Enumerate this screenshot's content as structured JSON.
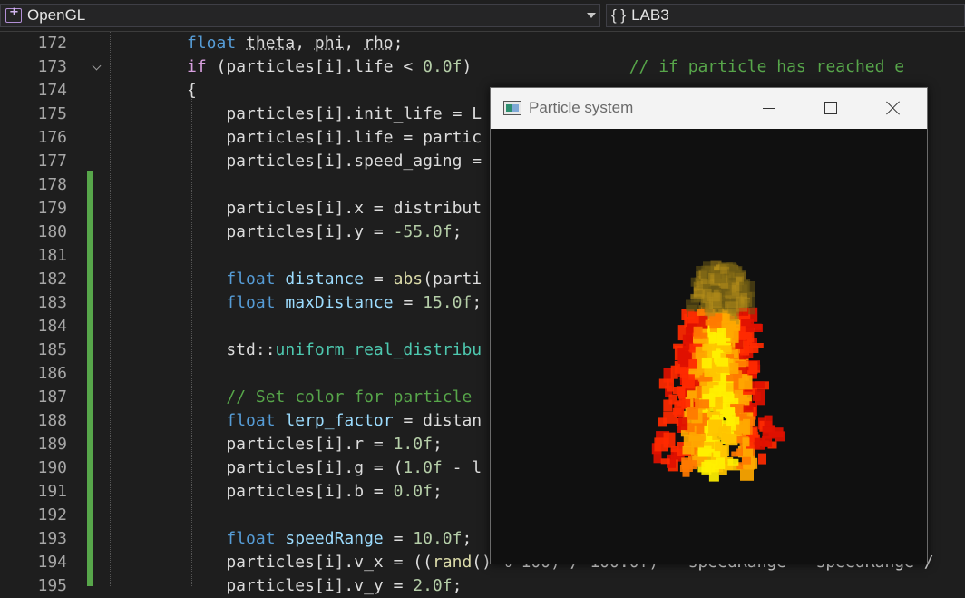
{
  "navbar": {
    "project": "OpenGL",
    "scope_icon": "{ }",
    "scope": "LAB3"
  },
  "colors": {
    "editor_bg": "#1e1e1e",
    "keyword": "#569cd6",
    "control_keyword": "#d8a0df",
    "comment": "#57a64a",
    "number": "#b5cea8",
    "type": "#4ec9b0",
    "change_bar": "#57a64a"
  },
  "editor": {
    "lines": [
      {
        "n": "172",
        "code": [
          [
            "kw",
            "float"
          ],
          [
            "t",
            " "
          ],
          [
            "lv",
            "theta"
          ],
          [
            "t",
            ", "
          ],
          [
            "lv",
            "phi"
          ],
          [
            "t",
            ", "
          ],
          [
            "lv",
            "rho"
          ],
          [
            "t",
            ";"
          ]
        ]
      },
      {
        "n": "173",
        "code": [
          [
            "kw2",
            "if"
          ],
          [
            "t",
            " (particles[i].life < "
          ],
          [
            "num",
            "0.0f"
          ],
          [
            "t",
            ")                "
          ],
          [
            "cm",
            "// if particle has reached e"
          ]
        ]
      },
      {
        "n": "174",
        "code": [
          [
            "t",
            "{"
          ]
        ]
      },
      {
        "n": "175",
        "code": [
          [
            "t",
            "    particles[i].init_life = L                                    All"
          ]
        ]
      },
      {
        "n": "176",
        "code": [
          [
            "t",
            "    particles[i].life = partic"
          ]
        ]
      },
      {
        "n": "177",
        "code": [
          [
            "t",
            "    particles[i].speed_aging ="
          ]
        ]
      },
      {
        "n": "178",
        "code": []
      },
      {
        "n": "179",
        "code": [
          [
            "t",
            "    particles[i].x = distribut"
          ]
        ]
      },
      {
        "n": "180",
        "code": [
          [
            "t",
            "    particles[i].y = "
          ],
          [
            "num",
            "-55.0f"
          ],
          [
            "t",
            ";"
          ]
        ]
      },
      {
        "n": "181",
        "code": []
      },
      {
        "n": "182",
        "code": [
          [
            "t",
            "    "
          ],
          [
            "kw",
            "float"
          ],
          [
            "t",
            " "
          ],
          [
            "var",
            "distance"
          ],
          [
            "t",
            " = "
          ],
          [
            "fn",
            "abs"
          ],
          [
            "t",
            "(parti"
          ]
        ]
      },
      {
        "n": "183",
        "code": [
          [
            "t",
            "    "
          ],
          [
            "kw",
            "float"
          ],
          [
            "t",
            " "
          ],
          [
            "var",
            "maxDistance"
          ],
          [
            "t",
            " = "
          ],
          [
            "num",
            "15.0f"
          ],
          [
            "t",
            ";"
          ]
        ]
      },
      {
        "n": "184",
        "code": []
      },
      {
        "n": "185",
        "code": [
          [
            "t",
            "    std::"
          ],
          [
            "ty",
            "uniform_real_distribu"
          ]
        ]
      },
      {
        "n": "186",
        "code": []
      },
      {
        "n": "187",
        "code": [
          [
            "t",
            "    "
          ],
          [
            "cm",
            "// Set color for particle"
          ]
        ]
      },
      {
        "n": "188",
        "code": [
          [
            "t",
            "    "
          ],
          [
            "kw",
            "float"
          ],
          [
            "t",
            " "
          ],
          [
            "var",
            "lerp_factor"
          ],
          [
            "t",
            " = distan"
          ]
        ]
      },
      {
        "n": "189",
        "code": [
          [
            "t",
            "    particles[i].r = "
          ],
          [
            "num",
            "1.0f"
          ],
          [
            "t",
            ";"
          ]
        ]
      },
      {
        "n": "190",
        "code": [
          [
            "t",
            "    particles[i].g = ("
          ],
          [
            "num",
            "1.0f"
          ],
          [
            "t",
            " - l"
          ]
        ]
      },
      {
        "n": "191",
        "code": [
          [
            "t",
            "    particles[i].b = "
          ],
          [
            "num",
            "0.0f"
          ],
          [
            "t",
            ";"
          ]
        ]
      },
      {
        "n": "192",
        "code": []
      },
      {
        "n": "193",
        "code": [
          [
            "t",
            "    "
          ],
          [
            "kw",
            "float"
          ],
          [
            "t",
            " "
          ],
          [
            "var",
            "speedRange"
          ],
          [
            "t",
            " = "
          ],
          [
            "num",
            "10.0f"
          ],
          [
            "t",
            ";"
          ]
        ]
      },
      {
        "n": "194",
        "code": [
          [
            "t",
            "    particles[i].v_x = (("
          ],
          [
            "fn",
            "rand"
          ],
          [
            "t",
            "() % 100) / 100.0f) * speedRange - speedRange /"
          ]
        ]
      },
      {
        "n": "195",
        "code": [
          [
            "t",
            "    particles[i].v_y = "
          ],
          [
            "num",
            "2.0f"
          ],
          [
            "t",
            ";"
          ]
        ]
      }
    ]
  },
  "particle_window": {
    "title": "Particle system",
    "title_icon": "app-window-icon",
    "buttons": {
      "minimize": "minimize-icon",
      "maximize": "maximize-icon",
      "close": "close-icon"
    },
    "flame_colors": [
      "#ff1a00",
      "#ff4d00",
      "#ff8a00",
      "#ffc400",
      "#fff000",
      "#b08a1a"
    ]
  }
}
